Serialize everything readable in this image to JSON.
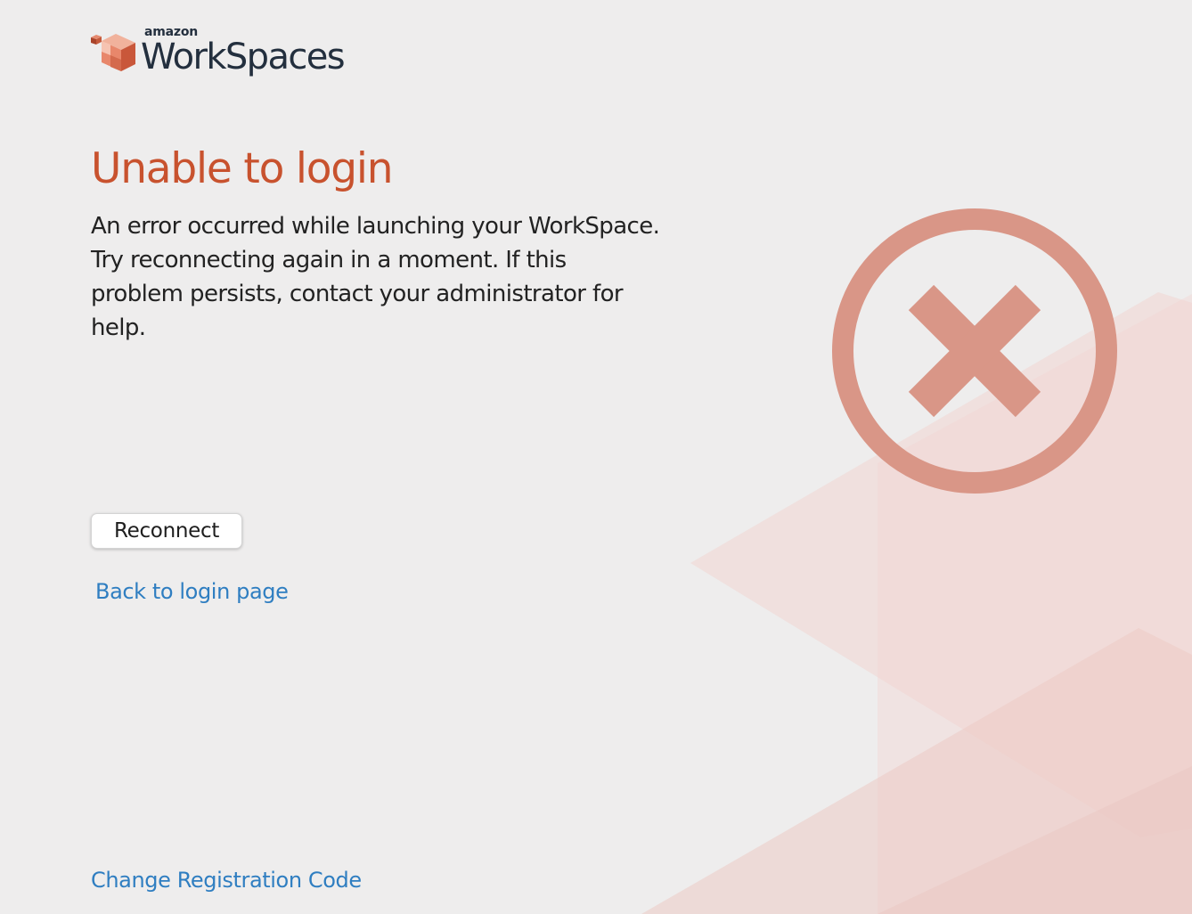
{
  "app": {
    "brand_small": "amazon",
    "brand_product": "WorkSpaces"
  },
  "error": {
    "title": "Unable to login",
    "message": "An error occurred while launching your WorkSpace. Try reconnecting again in a moment. If this problem persists, contact your administrator for help.",
    "icon": "error-x-circle-icon"
  },
  "actions": {
    "reconnect_label": "Reconnect",
    "back_to_login_label": "Back to login page",
    "change_registration_label": "Change Registration Code"
  },
  "colors": {
    "background": "#eeeded",
    "title": "#c8522e",
    "link": "#2f7ec1",
    "error_icon": "#d99687",
    "text": "#222222"
  }
}
